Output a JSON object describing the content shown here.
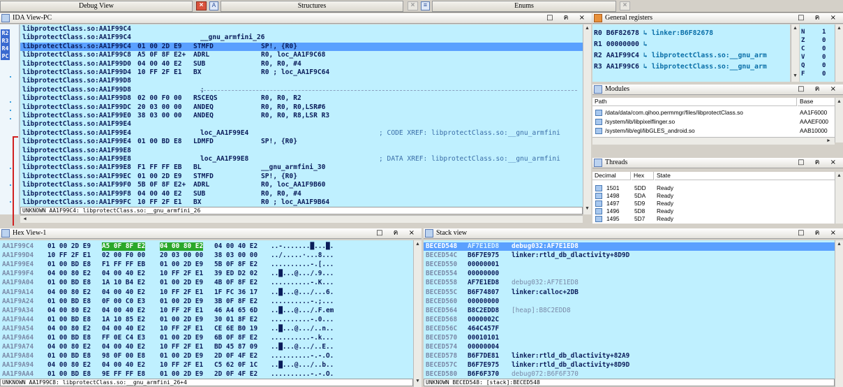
{
  "top_tabs": {
    "debug_view": "Debug View",
    "structures": "Structures",
    "enums": "Enums"
  },
  "ida_view": {
    "title": "IDA View-PC",
    "lines": [
      {
        "addr": "libprotectClass.so:AA1F99C4",
        "bytes": "",
        "mnem": "",
        "ops": "",
        "comment": "",
        "hl": false
      },
      {
        "addr": "libprotectClass.so:AA1F99C4",
        "bytes": "",
        "mnem": "",
        "ops": "",
        "comment": "",
        "hl": false,
        "label": "__gnu_armfini_26"
      },
      {
        "addr": "libprotectClass.so:AA1F99C4",
        "bytes": "01 00 2D E9",
        "mnem": "STMFD",
        "ops": "SP!, {R0}",
        "comment": "",
        "hl": true
      },
      {
        "addr": "libprotectClass.so:AA1F99C8",
        "bytes": "A5 0F 8F E2+",
        "mnem": "ADRL",
        "ops": "R0, loc_AA1F9C68",
        "comment": "",
        "hl": false
      },
      {
        "addr": "libprotectClass.so:AA1F99D0",
        "bytes": "04 00 40 E2",
        "mnem": "SUB",
        "ops": "R0, R0, #4",
        "comment": "",
        "hl": false
      },
      {
        "addr": "libprotectClass.so:AA1F99D4",
        "bytes": "10 FF 2F E1",
        "mnem": "BX",
        "ops": "R0 ; loc_AA1F9C64",
        "comment": "",
        "hl": false
      },
      {
        "addr": "libprotectClass.so:AA1F99D8",
        "bytes": "",
        "mnem": "",
        "ops": "",
        "comment": "",
        "hl": false
      },
      {
        "addr": "libprotectClass.so:AA1F99D8",
        "bytes": "",
        "mnem": "",
        "ops": "",
        "comment": "",
        "hl": false,
        "sep": ";"
      },
      {
        "addr": "libprotectClass.so:AA1F99D8",
        "bytes": "02 00 F0 00",
        "mnem": "RSCEQS",
        "ops": "R0, R0, R2",
        "comment": "",
        "hl": false
      },
      {
        "addr": "libprotectClass.so:AA1F99DC",
        "bytes": "20 03 00 00",
        "mnem": "ANDEQ",
        "ops": "R0, R0, R0,LSR#6",
        "comment": "",
        "hl": false
      },
      {
        "addr": "libprotectClass.so:AA1F99E0",
        "bytes": "38 03 00 00",
        "mnem": "ANDEQ",
        "ops": "R0, R0, R8,LSR R3",
        "comment": "",
        "hl": false
      },
      {
        "addr": "libprotectClass.so:AA1F99E4",
        "bytes": "",
        "mnem": "",
        "ops": "",
        "comment": "",
        "hl": false
      },
      {
        "addr": "libprotectClass.so:AA1F99E4",
        "bytes": "",
        "mnem": "",
        "ops": "",
        "comment": "; CODE XREF: libprotectClass.so:__gnu_armfini",
        "hl": false,
        "label": "loc_AA1F99E4"
      },
      {
        "addr": "libprotectClass.so:AA1F99E4",
        "bytes": "01 00 BD E8",
        "mnem": "LDMFD",
        "ops": "SP!, {R0}",
        "comment": "",
        "hl": false
      },
      {
        "addr": "libprotectClass.so:AA1F99E8",
        "bytes": "",
        "mnem": "",
        "ops": "",
        "comment": "",
        "hl": false
      },
      {
        "addr": "libprotectClass.so:AA1F99E8",
        "bytes": "",
        "mnem": "",
        "ops": "",
        "comment": "; DATA XREF: libprotectClass.so:__gnu_armfini",
        "hl": false,
        "label": "loc_AA1F99E8"
      },
      {
        "addr": "libprotectClass.so:AA1F99E8",
        "bytes": "F1 FF FF EB",
        "mnem": "BL",
        "ops": "__gnu_armfini_30",
        "comment": "",
        "hl": false
      },
      {
        "addr": "libprotectClass.so:AA1F99EC",
        "bytes": "01 00 2D E9",
        "mnem": "STMFD",
        "ops": "SP!, {R0}",
        "comment": "",
        "hl": false
      },
      {
        "addr": "libprotectClass.so:AA1F99F0",
        "bytes": "5B 0F 8F E2+",
        "mnem": "ADRL",
        "ops": "R0, loc_AA1F9B60",
        "comment": "",
        "hl": false
      },
      {
        "addr": "libprotectClass.so:AA1F99F8",
        "bytes": "04 00 40 E2",
        "mnem": "SUB",
        "ops": "R0, R0, #4",
        "comment": "",
        "hl": false
      },
      {
        "addr": "libprotectClass.so:AA1F99FC",
        "bytes": "10 FF 2F E1",
        "mnem": "BX",
        "ops": "R0 ; loc_AA1F9B64",
        "comment": "",
        "hl": false
      }
    ],
    "status": "UNKNOWN AA1F99C4: libprotectClass.so:__gnu_armfini_26",
    "side_icons": [
      "R2",
      "R3",
      "R4",
      "PC"
    ]
  },
  "registers": {
    "title": "General registers",
    "rows": [
      {
        "name": "R0",
        "value": "B6F82678",
        "symbol": "linker:B6F82678"
      },
      {
        "name": "R1",
        "value": "00000000",
        "symbol": ""
      },
      {
        "name": "R2",
        "value": "AA1F99C4",
        "symbol": "libprotectClass.so:__gnu_arm"
      },
      {
        "name": "R3",
        "value": "AA1F99C6",
        "symbol": "libprotectClass.so:__gnu_arm"
      }
    ],
    "flags": [
      {
        "name": "N",
        "value": "1"
      },
      {
        "name": "Z",
        "value": "0"
      },
      {
        "name": "C",
        "value": "0"
      },
      {
        "name": "V",
        "value": "0"
      },
      {
        "name": "Q",
        "value": "0"
      },
      {
        "name": "F",
        "value": "0"
      }
    ]
  },
  "modules": {
    "title": "Modules",
    "col_path": "Path",
    "col_base": "Base",
    "rows": [
      {
        "path": "/data/data/com.qihoo.permmgr/files/libprotectClass.so",
        "base": "AA1F6000"
      },
      {
        "path": "/system/lib/libpixelflinger.so",
        "base": "AAAEF000"
      },
      {
        "path": "/system/lib/egl/libGLES_android.so",
        "base": "AAB10000"
      }
    ]
  },
  "threads": {
    "title": "Threads",
    "col_decimal": "Decimal",
    "col_hex": "Hex",
    "col_state": "State",
    "rows": [
      {
        "dec": "1501",
        "hex": "5DD",
        "state": "Ready"
      },
      {
        "dec": "1498",
        "hex": "5DA",
        "state": "Ready"
      },
      {
        "dec": "1497",
        "hex": "5D9",
        "state": "Ready"
      },
      {
        "dec": "1496",
        "hex": "5D8",
        "state": "Ready"
      },
      {
        "dec": "1495",
        "hex": "5D7",
        "state": "Ready"
      }
    ]
  },
  "hex_view": {
    "title": "Hex View-1",
    "rows": [
      {
        "addr": "AA1F99C4",
        "b1": "01 00 2D E9",
        "b2": "A5 0F 8F E2",
        "b3": "04 00 80 E2",
        "b4": "04 00 40 E2",
        "ascii": "..-.......█...█."
      },
      {
        "addr": "AA1F99D4",
        "b1": "10 FF 2F E1",
        "b2": "02 00 F0 00",
        "b3": "20 03 00 00",
        "b4": "38 03 00 00",
        "ascii": "../.....·...8..."
      },
      {
        "addr": "AA1F99E4",
        "b1": "01 00 BD E8",
        "b2": "F1 FF FF EB",
        "b3": "01 00 2D E9",
        "b4": "5B 0F 8F E2",
        "ascii": "..........-.[..."
      },
      {
        "addr": "AA1F99F4",
        "b1": "04 00 80 E2",
        "b2": "04 00 40 E2",
        "b3": "10 FF 2F E1",
        "b4": "39 ED D2 02",
        "ascii": "..█...@.../.9..."
      },
      {
        "addr": "AA1F9A04",
        "b1": "01 00 BD E8",
        "b2": "1A 10 B4 E2",
        "b3": "01 00 2D E9",
        "b4": "4B 0F 8F E2",
        "ascii": "..........-.K..."
      },
      {
        "addr": "AA1F9A14",
        "b1": "04 00 80 E2",
        "b2": "04 00 40 E2",
        "b3": "10 FF 2F E1",
        "b4": "1F FC 36 17",
        "ascii": "..█...@.../...6."
      },
      {
        "addr": "AA1F9A24",
        "b1": "01 00 BD E8",
        "b2": "0F 00 C0 E3",
        "b3": "01 00 2D E9",
        "b4": "3B 0F 8F E2",
        "ascii": "..........-.;..."
      },
      {
        "addr": "AA1F9A34",
        "b1": "04 00 80 E2",
        "b2": "04 00 40 E2",
        "b3": "10 FF 2F E1",
        "b4": "46 A4 65 6D",
        "ascii": "..█...@.../.F.em"
      },
      {
        "addr": "AA1F9A44",
        "b1": "01 00 BD E8",
        "b2": "1A 10 85 E2",
        "b3": "01 00 2D E9",
        "b4": "30 01 8F E2",
        "ascii": "..........-.0..."
      },
      {
        "addr": "AA1F9A54",
        "b1": "04 00 80 E2",
        "b2": "04 00 40 E2",
        "b3": "10 FF 2F E1",
        "b4": "CE 6E B0 19",
        "ascii": "..█...@.../..n.."
      },
      {
        "addr": "AA1F9A64",
        "b1": "01 00 BD E8",
        "b2": "FF 0E C4 E3",
        "b3": "01 00 2D E9",
        "b4": "6B 0F 8F E2",
        "ascii": "..........-.k..."
      },
      {
        "addr": "AA1F9A74",
        "b1": "04 00 80 E2",
        "b2": "04 00 40 E2",
        "b3": "10 FF 2F E1",
        "b4": "BD 45 87 09",
        "ascii": "..█...@.../..E.."
      },
      {
        "addr": "AA1F9A84",
        "b1": "01 00 BD E8",
        "b2": "98 0F 00 E8",
        "b3": "01 00 2D E9",
        "b4": "2D 0F 4F E2",
        "ascii": "..........-.-.O."
      },
      {
        "addr": "AA1F9A94",
        "b1": "04 00 80 E2",
        "b2": "04 00 40 E2",
        "b3": "10 FF 2F E1",
        "b4": "C5 62 0F 1C",
        "ascii": "..█...@.../..b.."
      },
      {
        "addr": "AA1F9AA4",
        "b1": "01 00 BD E8",
        "b2": "9E FF FF E8",
        "b3": "01 00 2D E9",
        "b4": "2D 0F 4F E2",
        "ascii": "..........-.-.O."
      }
    ],
    "status": "UNKNOWN AA1F99C8: libprotectClass.so:__gnu_armfini_26+4"
  },
  "stack_view": {
    "title": "Stack view",
    "rows": [
      {
        "addr": "BECED548",
        "value": "AF7E1ED8",
        "comment": "debug032:AF7E1ED8",
        "hl": true
      },
      {
        "addr": "BECED54C",
        "value": "B6F7E975",
        "comment": "linker:rtld_db_dlactivity+8D9D",
        "hl": false
      },
      {
        "addr": "BECED550",
        "value": "00000001",
        "comment": "",
        "hl": false
      },
      {
        "addr": "BECED554",
        "value": "00000000",
        "comment": "",
        "hl": false
      },
      {
        "addr": "BECED558",
        "value": "AF7E1ED8",
        "comment": "debug032:AF7E1ED8",
        "hl": false
      },
      {
        "addr": "BECED55C",
        "value": "B6F74807",
        "comment": "linker:calloc+2DB",
        "hl": false
      },
      {
        "addr": "BECED560",
        "value": "00000000",
        "comment": "",
        "hl": false
      },
      {
        "addr": "BECED564",
        "value": "B8C2EDD8",
        "comment": "[heap]:B8C2EDD8",
        "hl": false
      },
      {
        "addr": "BECED568",
        "value": "0000002C",
        "comment": "",
        "hl": false
      },
      {
        "addr": "BECED56C",
        "value": "464C457F",
        "comment": "",
        "hl": false
      },
      {
        "addr": "BECED570",
        "value": "00010101",
        "comment": "",
        "hl": false
      },
      {
        "addr": "BECED574",
        "value": "00000004",
        "comment": "",
        "hl": false
      },
      {
        "addr": "BECED578",
        "value": "B6F7DE81",
        "comment": "linker:rtld_db_dlactivity+82A9",
        "hl": false
      },
      {
        "addr": "BECED57C",
        "value": "B6F7E975",
        "comment": "linker:rtld_db_dlactivity+8D9D",
        "hl": false
      },
      {
        "addr": "BECED580",
        "value": "B6F6F370",
        "comment": "debug072:B6F6F370",
        "hl": false
      }
    ],
    "status": "UNKNOWN BECED548: [stack]:BECED548"
  },
  "window_buttons": {
    "min": "□",
    "restore": "ฅ",
    "close": "×"
  }
}
